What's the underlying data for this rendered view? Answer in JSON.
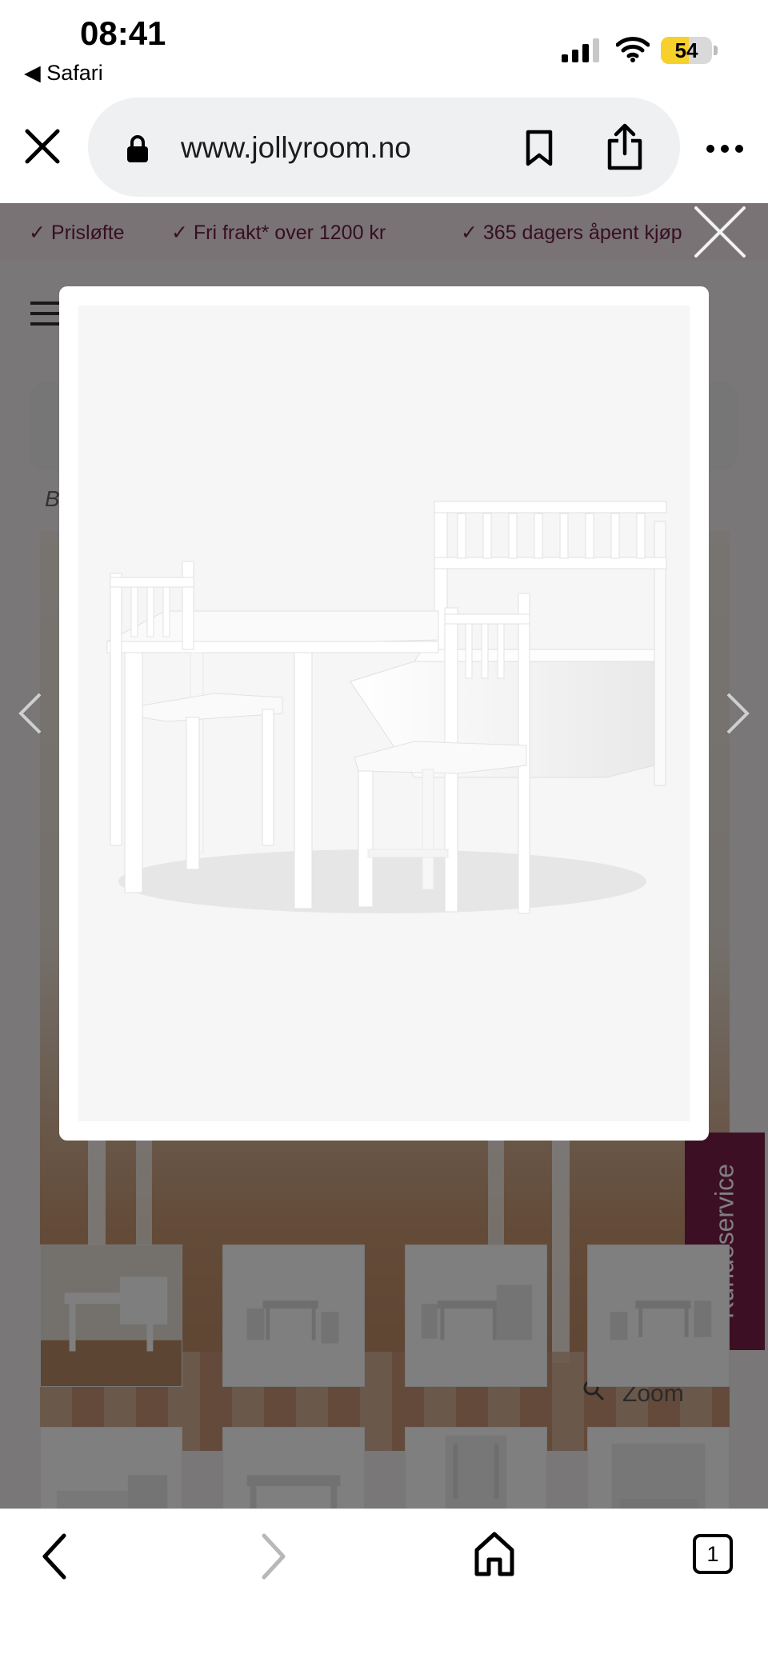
{
  "status_bar": {
    "time": "08:41",
    "back_app": "◀ Safari",
    "battery": "54",
    "battery_level_percent": 54
  },
  "address_bar": {
    "url": "www.jollyroom.no"
  },
  "page": {
    "usp_items": [
      "✓ Prisløfte",
      "✓ Fri frakt* over 1200 kr",
      "✓ 365 dagers åpent kjøp"
    ],
    "breadcrumb_hint": "B",
    "kundeservice": "Kundeservice",
    "zoom": "Zoom"
  },
  "colors": {
    "brand": "#7b1e4a",
    "usp_text": "#6c1d45",
    "battery": "#f7d02c"
  },
  "toolbar": {
    "tabs_count": "1"
  },
  "icons": [
    "close-icon",
    "lock-icon",
    "bookmark-icon",
    "share-icon",
    "more-icon",
    "hamburger-icon",
    "chevron-left-icon",
    "chevron-right-icon",
    "home-icon",
    "tabs-icon",
    "search-icon"
  ]
}
